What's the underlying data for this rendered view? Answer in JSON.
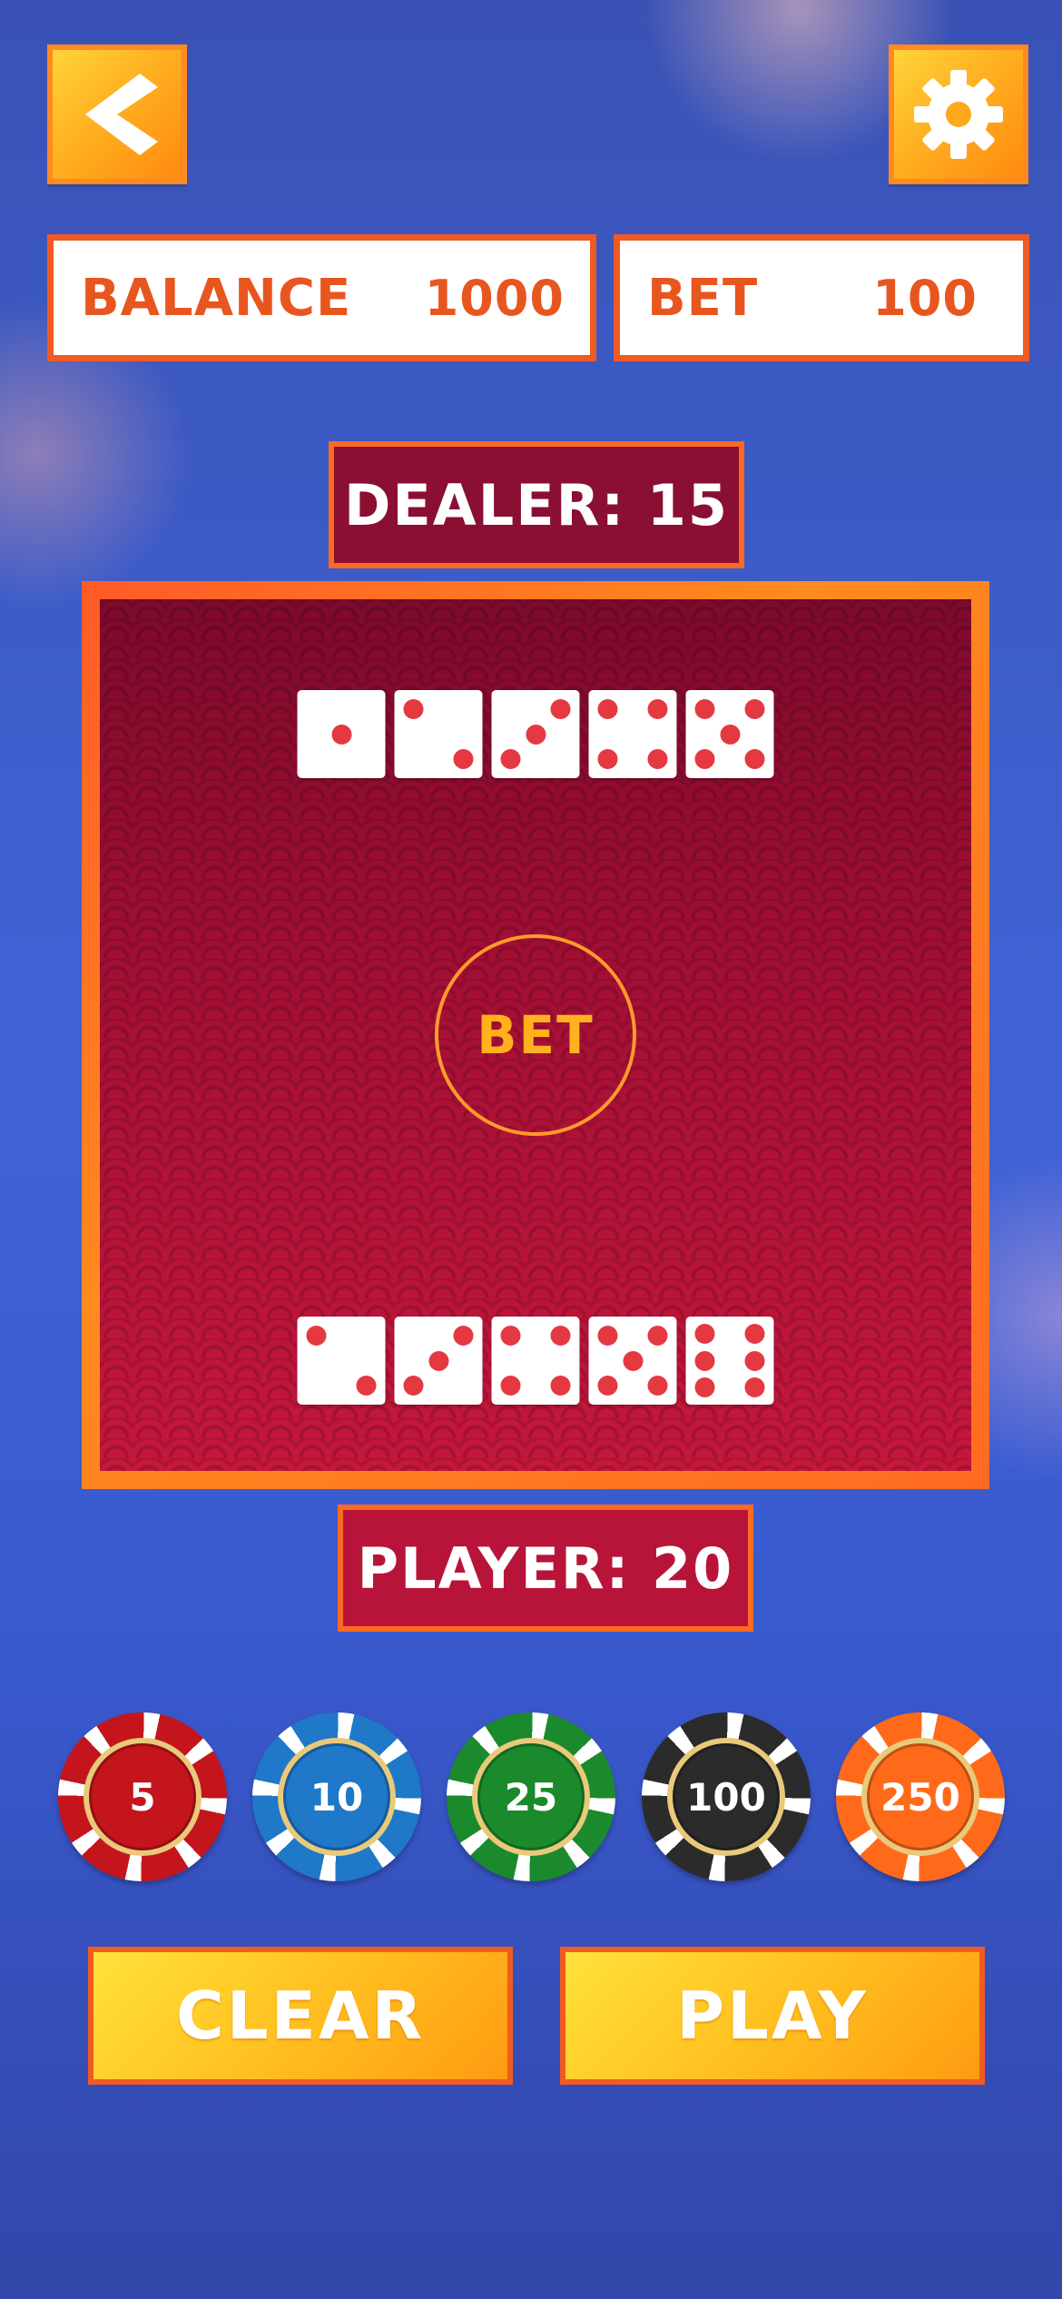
{
  "header": {
    "back_icon": "chevron-left-icon",
    "settings_icon": "gear-icon"
  },
  "balance": {
    "label": "BALANCE",
    "value": "1000"
  },
  "bet": {
    "label": "BET",
    "value": "100"
  },
  "dealer": {
    "label": "DEALER: 15",
    "dice": [
      1,
      2,
      3,
      4,
      5
    ]
  },
  "player": {
    "label": "PLAYER: 20",
    "dice": [
      2,
      3,
      4,
      5,
      6
    ]
  },
  "table": {
    "bet_spot_label": "BET"
  },
  "chips": [
    {
      "value": "5",
      "color": "#c4151c"
    },
    {
      "value": "10",
      "color": "#1f78c8"
    },
    {
      "value": "25",
      "color": "#1b8a2c"
    },
    {
      "value": "100",
      "color": "#2b2b2b"
    },
    {
      "value": "250",
      "color": "#ff6a1a"
    }
  ],
  "actions": {
    "clear_label": "CLEAR",
    "play_label": "PLAY"
  },
  "colors": {
    "accent_orange": "#ff8a1f",
    "table_red": "#9b0d33",
    "pip_red": "#e53942"
  }
}
